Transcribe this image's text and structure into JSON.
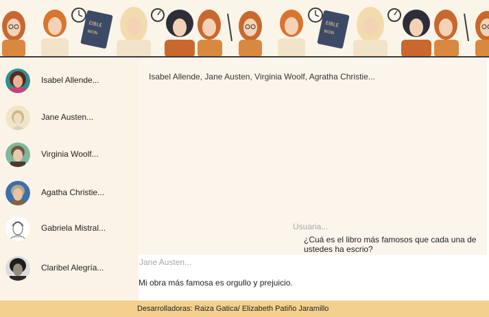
{
  "chat": {
    "title": "Isabel Allende, Jane Austen, Virginia Woolf, Agratha Christie...",
    "messages": [
      {
        "sender": "Usuaria...",
        "text": "¿Cuá es el libro más famosos que cada una de ustedes ha escrio?"
      },
      {
        "sender": "Jane Austen...",
        "text": "Mi obra más famosa es orgullo y prejuicio."
      }
    ]
  },
  "contacts": [
    {
      "name": "Isabel Allende...",
      "icon": "isabel-allende-avatar"
    },
    {
      "name": "Jane Austen...",
      "icon": "jane-austen-avatar"
    },
    {
      "name": "Virginia Woolf...",
      "icon": "virginia-woolf-avatar"
    },
    {
      "name": "Agatha Christie...",
      "icon": "agatha-christie-avatar"
    },
    {
      "name": "Gabriela Mistral...",
      "icon": "gabriela-mistral-avatar"
    },
    {
      "name": "Claribel Alegría...",
      "icon": "claribel-alegria-avatar"
    }
  ],
  "footer": {
    "text": "Desarrolladoras: Raiza Gatica/ Elizabeth Patiño Jaramillo"
  },
  "colors": {
    "footer": "#f3d08e",
    "sidebar": "#fcf3e7",
    "accent_orange": "#c8682e"
  }
}
